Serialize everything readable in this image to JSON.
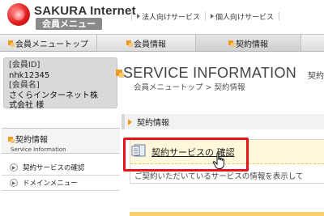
{
  "header": {
    "brand_name": "SAKURA Internet",
    "brand_sub": "会員メニュー",
    "util_links": [
      {
        "label": "法人向けサービス"
      },
      {
        "label": "個人向けサービス"
      }
    ]
  },
  "nav": {
    "tabs": [
      {
        "label": "会員メニュートップ"
      },
      {
        "label": "会員情報"
      },
      {
        "label": "契約情報"
      },
      {
        "label": ""
      }
    ]
  },
  "member": {
    "id_label": "[会員ID]",
    "id_value": "nhk12345",
    "name_label": "[会員名]",
    "name_value_line1": "さくらインターネット株",
    "name_value_line2": "式会社 様"
  },
  "sidebar": {
    "section_title": "契約情報",
    "section_sub": "Service Information",
    "items": [
      {
        "label": "契約サービスの確認"
      },
      {
        "label": "ドメインメニュー"
      }
    ]
  },
  "main": {
    "title": "SERVICE INFORMATION",
    "title_right": "契約",
    "breadcrumb": "会員メニュートップ > 契約情報",
    "section_label": "契約情報",
    "action_link": "契約サービスの 確認",
    "description": "ご契約いただいているサービスの情報を表示して"
  },
  "colors": {
    "accent_orange": "#f29a1f",
    "highlight_red": "#e8121b",
    "card_yellow": "#fff7d9"
  }
}
